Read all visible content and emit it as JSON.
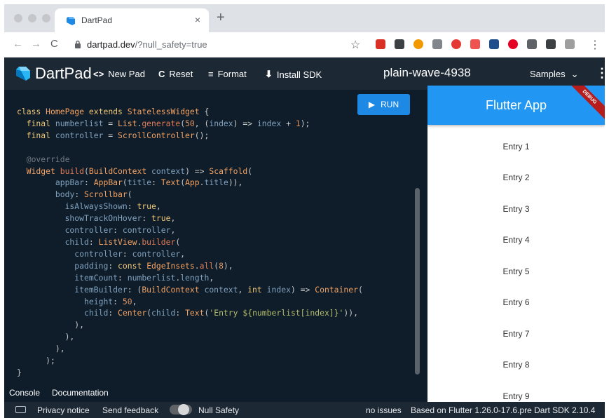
{
  "browser": {
    "tab_title": "DartPad",
    "tab_close": "×",
    "new_tab": "+",
    "url_host": "dartpad.dev",
    "url_path": "/?null_safety=true",
    "nav_back": "←",
    "nav_forward": "→",
    "nav_reload": "C",
    "bookmark_star": "☆",
    "menu": "⋮"
  },
  "header": {
    "title": "DartPad",
    "actions": [
      {
        "icon": "<>",
        "label": "New Pad"
      },
      {
        "icon": "C",
        "label": "Reset"
      },
      {
        "icon": "≡",
        "label": "Format"
      },
      {
        "icon": "⬇",
        "label": "Install SDK"
      }
    ],
    "project_name": "plain-wave-4938",
    "samples_label": "Samples",
    "samples_chevron": "⌄",
    "more": "⋮"
  },
  "editor": {
    "run_label": "RUN",
    "run_icon": "▶"
  },
  "preview": {
    "app_title": "Flutter App",
    "debug_banner": "DEBUG",
    "entries": [
      "Entry 1",
      "Entry 2",
      "Entry 3",
      "Entry 4",
      "Entry 5",
      "Entry 6",
      "Entry 7",
      "Entry 8",
      "Entry 9"
    ]
  },
  "console_bar": {
    "console": "Console",
    "documentation": "Documentation"
  },
  "footer": {
    "privacy": "Privacy notice",
    "feedback": "Send feedback",
    "null_safety": "Null Safety",
    "issues": "no issues",
    "version": "Based on Flutter 1.26.0-17.6.pre Dart SDK 2.10.4"
  },
  "colors": {
    "header_bg": "#1c2834",
    "editor_bg": "#0f1d2b",
    "run_button": "#1e88e5",
    "appbar": "#2196f3",
    "debug_banner": "#b71c1c"
  }
}
